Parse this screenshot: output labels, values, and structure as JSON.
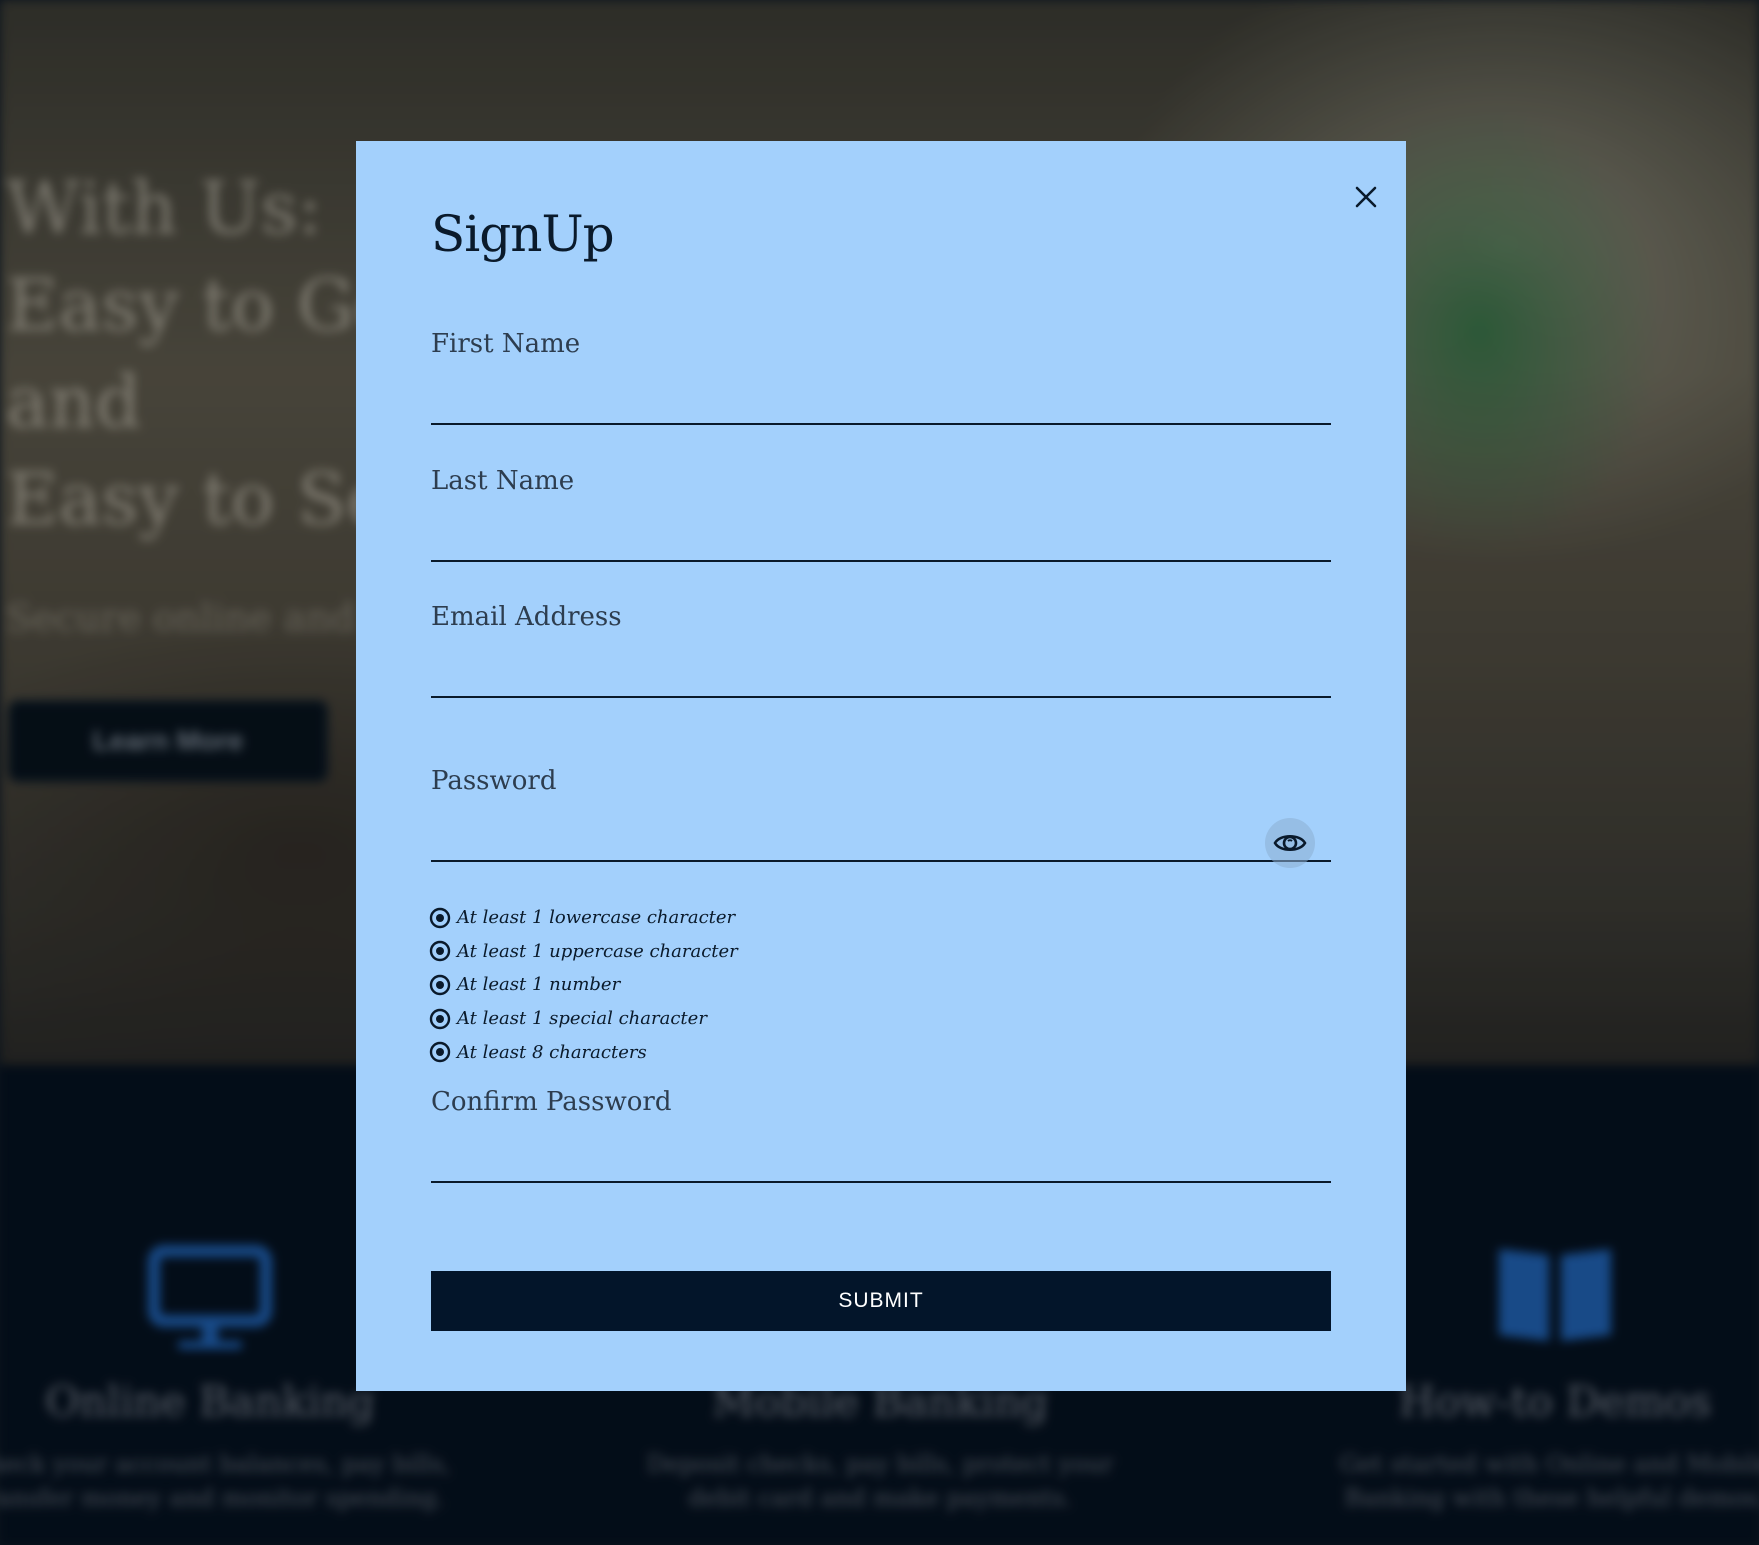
{
  "background": {
    "hero": {
      "headline_lines": [
        "With Us:",
        "Easy to Ge",
        "and",
        "Easy to Se"
      ],
      "subtitle": "Secure online and",
      "button_label": "Learn More"
    },
    "features": [
      {
        "icon": "monitor-icon",
        "title": "Online Banking",
        "description": "Check your account balances, pay bills, transfer money and monitor spending."
      },
      {
        "icon": "phone-icon",
        "title": "Mobile Banking",
        "description": "Deposit checks, pay bills, protect your debit card and make payments."
      },
      {
        "icon": "book-icon",
        "title": "How-to Demos",
        "description": "Get started with Online and Mobile Banking with these helpful demos."
      }
    ]
  },
  "modal": {
    "title": "SignUp",
    "close_icon": "close-icon",
    "fields": {
      "first_name": {
        "label": "First Name",
        "value": ""
      },
      "last_name": {
        "label": "Last Name",
        "value": ""
      },
      "email": {
        "label": "Email Address",
        "value": ""
      },
      "password": {
        "label": "Password",
        "value": "",
        "toggle_icon": "eye-icon"
      },
      "confirm_password": {
        "label": "Confirm Password",
        "value": ""
      }
    },
    "password_rules": [
      {
        "text": "At least 1 lowercase character",
        "icon": "radio-dot-icon"
      },
      {
        "text": "At least 1 uppercase character",
        "icon": "radio-dot-icon"
      },
      {
        "text": "At least 1 number",
        "icon": "radio-dot-icon"
      },
      {
        "text": "At least 1 special character",
        "icon": "radio-dot-icon"
      },
      {
        "text": "At least 8 characters",
        "icon": "radio-dot-icon"
      }
    ],
    "submit_label": "SUBMIT"
  },
  "colors": {
    "modal_background": "#a3d0fc",
    "button_background": "#03152a",
    "text_dark": "#0a1a2b",
    "label_text": "#2d3d4f",
    "feature_icon_blue": "#1f5fae"
  }
}
